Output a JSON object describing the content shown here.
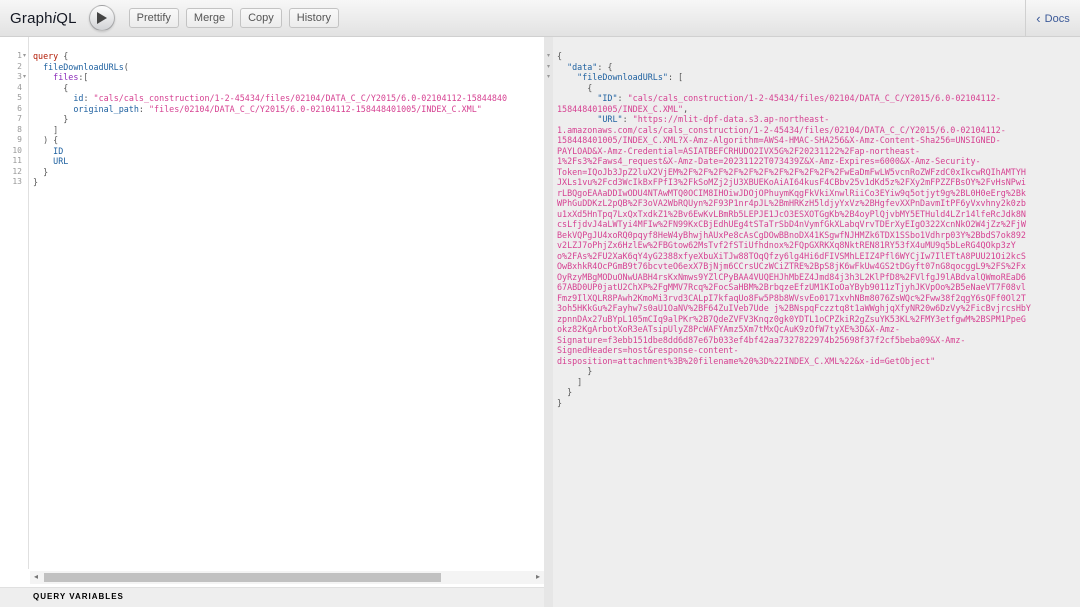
{
  "app": {
    "title_prefix": "Graph",
    "title_italic": "i",
    "title_suffix": "QL"
  },
  "toolbar": {
    "execute_icon": "play-icon",
    "buttons": [
      "Prettify",
      "Merge",
      "Copy",
      "History"
    ],
    "docs_label": "Docs",
    "docs_icon": "chevron-left-icon"
  },
  "query_editor": {
    "line_numbers": [
      "1",
      "2",
      "3",
      "4",
      "5",
      "6",
      "7",
      "8",
      "9",
      "10",
      "11",
      "12",
      "13"
    ],
    "keyword": "query",
    "field": "fileDownloadURLs",
    "arg_name": "files",
    "id_key": "id",
    "id_value": "\"cals/cals_construction/1-2-45434/files/02104/DATA_C_C/Y2015/6.0-02104112-15844840",
    "path_key": "original_path",
    "path_value": "\"files/02104/DATA_C_C/Y2015/6.0-02104112-158448401005/INDEX_C.XML\"",
    "select_fields": [
      "ID",
      "URL"
    ]
  },
  "query_variables_label": "QUERY VARIABLES",
  "result": {
    "data_key": "\"data\"",
    "field_key": "\"fileDownloadURLs\"",
    "id_key": "\"ID\"",
    "id_value_lines": [
      "\"cals/cals_construction/1-2-45434/files/02104/DATA_C_C/Y2015/6.0-02104112-",
      "158448401005/INDEX_C.XML\""
    ],
    "url_key": "\"URL\"",
    "url_value_lines": [
      "\"https://mlit-dpf-data.s3.ap-northeast-",
      "1.amazonaws.com/cals/cals_construction/1-2-45434/files/02104/DATA_C_C/Y2015/6.0-02104112-",
      "158448401005/INDEX_C.XML?X-Amz-Algorithm=AWS4-HMAC-SHA256&X-Amz-Content-Sha256=UNSIGNED-",
      "PAYLOAD&X-Amz-Credential=ASIATBEFCRHUDO2IVX5G%2F20231122%2Fap-northeast-",
      "1%2Fs3%2Faws4_request&X-Amz-Date=20231122T073439Z&X-Amz-Expires=6000&X-Amz-Security-",
      "Token=IQoJb3JpZ2luX2VjEM%2F%2F%2F%2F%2F%2F%2F%2F%2F%2F%2FwEaDmFwLW5vcnRoZWFzdC0xIkcwRQIhAMTYH",
      "JXLs1vu%2Fcd3WcIkBxFPfI3%2FkSoMZj2jU3XBUEKoAiAI64kusF4CBbv25v1dKd5z%2FXy2mFPZZFBsOY%2FvHsNPwi",
      "rLBQgoEAAaDDIwODU4NTAwMTQ0OCIM8IHOiwJDOjOPhuymKqgFkVkiXnwlRiiCo3EYiw9q5otjyt9g%2BL0H0eErg%2Bk",
      "WPhGuDDKzL2pQB%2F3oVA2WbRQUyn%2F93P1nr4pJL%2BmHRKzH5ldjyYxVz%2BHgfevXXPnDavmItPF6yVxvhny2k0zb",
      "u1xXd5HnTpq7LxQxTxdkZ1%2Bv6EwKvLBmRb5LEPJE1JcO3ESXOTGgKb%2B4oyPlQjvbMY5ETHuld4LZr14lfeRcJdk8N",
      "csLfjdvJ4aLWTyi4MFIw%2FN99KxCBjEdhUEg4tSTaTrSbD4nVymfGkXLabqVrvTDErXyEIgO322XcnNkO2W4jZz%2FjW",
      "BekVQPgJU4xoRQ0pqyf8HeW4yBhwjhAUxPe8cAsCgDOwBBnoDX41KSgwfNJHMZk6TDX1SSbo1Vdhrp03Y%2BbdS7ok892",
      "v2LZJ7oPhjZx6HzlEw%2FBGtow62MsTvf2fSTiUfhdnox%2FQpGXRKXq8NktREN81RY53fX4uMU9q5bLeRG4QOkp3zY",
      "o%2FAs%2FU2XaK6qY4yG2388xfyeXbuXiTJw88TOqQfzy6lg4Hi6dFIVSMhLEIZ4Pfl6WYCjIw7IlETtA8PUU21Oi2kcS",
      "OwBxhkR4OcPGmB9t76bcvteO6exX7BjNjm6CCrsUCzWCiZTRE%2BpS8jK6wFkUw4GS2tDGyft07nG8qocggL9%2FS%2Fx",
      "OyRzyMBgMODuONwUABH4rsKxNmws9YZlCPyBAA4VUQEHJhMbEZ4Jmd84j3h3L2KlPfD8%2FVlfgJ9lABdvalQWmoREaD6",
      "67ABD0UP0jatU2ChXP%2FgMMV7Rcq%2FocSaHBM%2BrbqzeEfzUM1KIoOaYByb9011zTjyhJKVpOo%2B5eNaeVT7F08vl",
      "Fmz9IlXQLR8PAwh2KmoMi3rvd3CALpI7kfaqUo8Fw5P8b8WVsvEo0171xvhNBm8076ZsWQc%2Fww38f2qgY6sQFf0Ol2T",
      "3oh5HKkGu%2Fayhw7s0aU1OaNV%2BF64ZuIVeb7Ude j%2BNspqFczztq8t1aWWghjqXfyNR20w6DzVy%2FicBvjrcsHbY",
      "zpnnDAx27uBYpL105mCIq9alPKr%2B7QdeZVFV3Knqz0gk0YDTL1oCPZkiR2gZsuYK53KL%2FMY3etfgwM%2BSPM1PpeG",
      "okz82KgArbotXoR3eATsipUlyZ8PcWAFYAmz5Xm7tMxQcAuK9zOfW7tyXE%3D&X-Amz-",
      "Signature=f3ebb151dbe8dd6d87e67b033ef4bf42aa7327822974b25698f37f2cf5beba09&X-Amz-",
      "SignedHeaders=host&response-content-",
      "disposition=attachment%3B%20filename%20%3D%22INDEX_C.XML%22&x-id=GetObject\""
    ]
  }
}
